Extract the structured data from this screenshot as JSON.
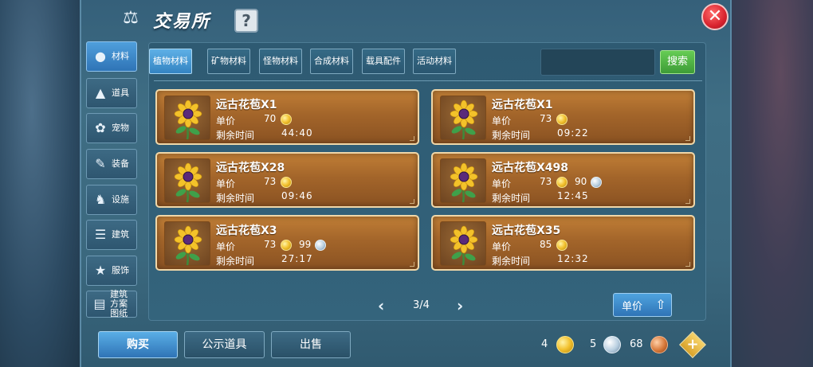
{
  "window": {
    "title": "交易所",
    "title_icon": "scale-icon",
    "help_label": "?",
    "close_label": "✕"
  },
  "sidebar": {
    "items": [
      {
        "label": "材料",
        "icon": "materials-icon",
        "active": true
      },
      {
        "label": "道具",
        "icon": "potion-icon",
        "active": false
      },
      {
        "label": "宠物",
        "icon": "paw-icon",
        "active": false
      },
      {
        "label": "装备",
        "icon": "equipment-icon",
        "active": false
      },
      {
        "label": "设施",
        "icon": "facility-icon",
        "active": false
      },
      {
        "label": "建筑",
        "icon": "building-icon",
        "active": false
      },
      {
        "label": "服饰",
        "icon": "clothing-icon",
        "active": false
      },
      {
        "label": "建筑方案图纸",
        "icon": "blueprint-icon",
        "active": false
      }
    ]
  },
  "tabs": [
    {
      "label": "植物材料",
      "active": true
    },
    {
      "label": "矿物材料",
      "active": false
    },
    {
      "label": "怪物材料",
      "active": false
    },
    {
      "label": "合成材料",
      "active": false
    },
    {
      "label": "载具配件",
      "active": false
    },
    {
      "label": "活动材料",
      "active": false
    }
  ],
  "search": {
    "placeholder": "",
    "value": "",
    "button_label": "搜索"
  },
  "labels": {
    "price": "单价",
    "time": "剩余时间"
  },
  "listings": [
    {
      "name": "远古花苞X1",
      "gold": "70",
      "silver": "",
      "time": "44:40"
    },
    {
      "name": "远古花苞X1",
      "gold": "73",
      "silver": "",
      "time": "09:22"
    },
    {
      "name": "远古花苞X28",
      "gold": "73",
      "silver": "",
      "time": "09:46"
    },
    {
      "name": "远古花苞X498",
      "gold": "73",
      "silver": "90",
      "time": "12:45"
    },
    {
      "name": "远古花苞X3",
      "gold": "73",
      "silver": "99",
      "time": "27:17"
    },
    {
      "name": "远古花苞X35",
      "gold": "85",
      "silver": "",
      "time": "12:32"
    }
  ],
  "pagination": {
    "text": "3/4",
    "prev": "‹",
    "next": "›"
  },
  "sort": {
    "label": "单价",
    "icon": "sort-up-icon"
  },
  "actions": {
    "buy": "购买",
    "public_items": "公示道具",
    "sell": "出售"
  },
  "currency": {
    "gold": "4",
    "silver": "5",
    "copper": "68",
    "add_label": "+"
  },
  "colors": {
    "gold_coin": "#f2c12e",
    "silver_coin": "#b9cfe0",
    "copper_coin": "#d8793a",
    "active_tab": "#3484c2",
    "search_button": "#3e9c37",
    "close_button": "#d9232e",
    "card": "#a3652a"
  }
}
